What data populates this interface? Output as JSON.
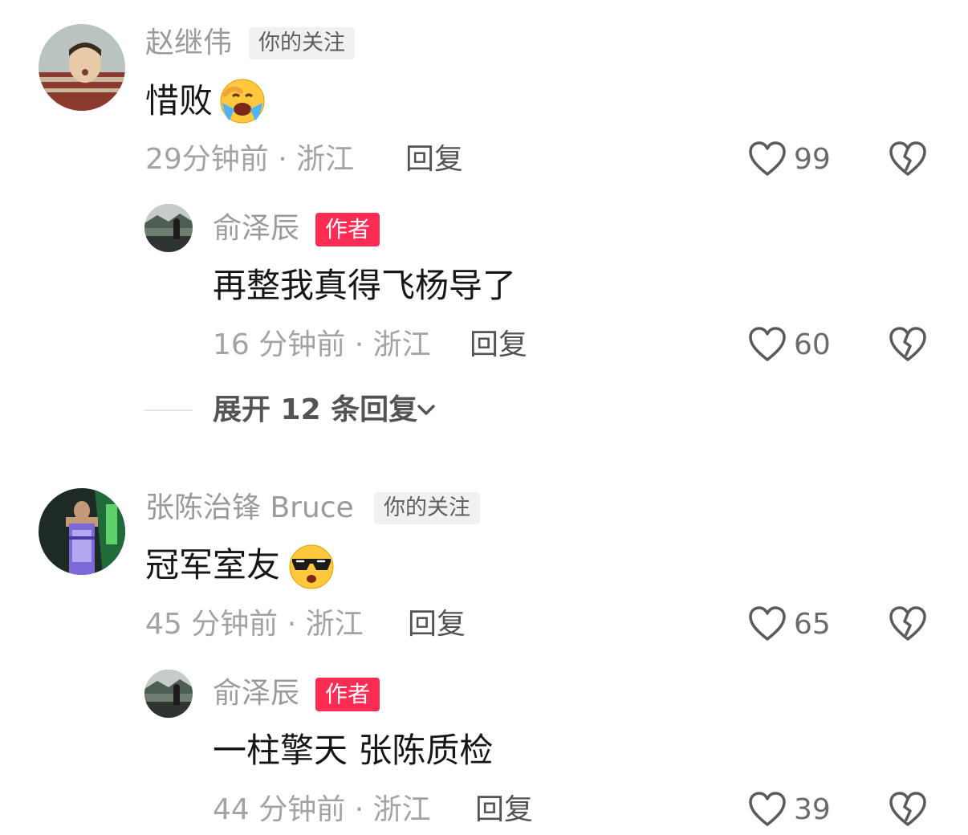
{
  "comments": [
    {
      "username": "赵继伟",
      "tag": "你的关注",
      "text": "惜败",
      "emoji": "crying-emoji",
      "time_location": "29分钟前 · 浙江",
      "reply_label": "回复",
      "likes": "99",
      "replies": [
        {
          "username": "俞泽辰",
          "tag": "作者",
          "text": "再整我真得飞杨导了",
          "time_location": "16 分钟前 · 浙江",
          "reply_label": "回复",
          "likes": "60"
        }
      ],
      "expand_label": "展开 12 条回复"
    },
    {
      "username": "张陈治锋 Bruce",
      "tag": "你的关注",
      "text": "冠军室友",
      "emoji": "cool-sunglasses-emoji",
      "time_location": "45 分钟前 · 浙江",
      "reply_label": "回复",
      "likes": "65",
      "replies": [
        {
          "username": "俞泽辰",
          "tag": "作者",
          "text": "一柱擎天 张陈质检",
          "time_location": "44 分钟前 · 浙江",
          "reply_label": "回复",
          "likes": "39"
        }
      ]
    }
  ],
  "colors": {
    "author_tag": "#fe2c55",
    "follow_tag_bg": "#f1f1f1"
  },
  "icons": {
    "like": "heart-outline-icon",
    "dislike": "broken-heart-icon",
    "expand": "chevron-down-icon"
  }
}
